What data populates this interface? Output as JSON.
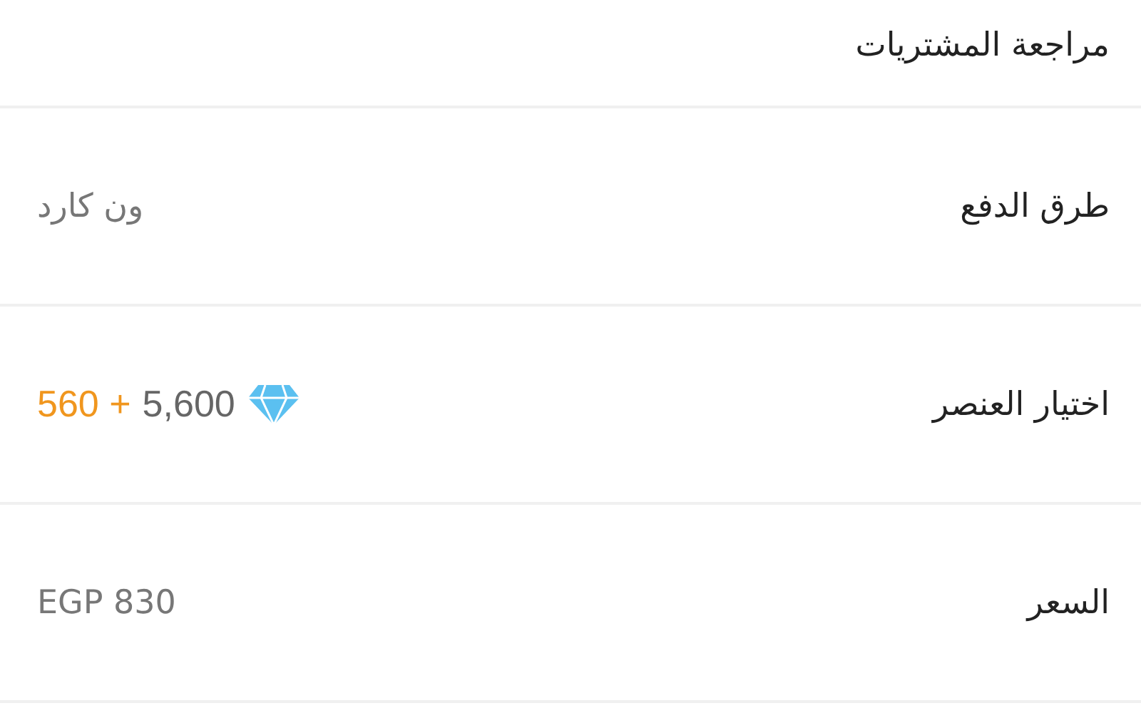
{
  "header": {
    "title": "مراجعة المشتريات"
  },
  "rows": [
    {
      "kind": "text",
      "label": "طرق الدفع",
      "value": "ون كارد"
    },
    {
      "kind": "gems",
      "label": "اختيار العنصر",
      "bonus": "560 +",
      "amount": "5,600"
    },
    {
      "kind": "text",
      "label": "السعر",
      "value": "EGP 830"
    }
  ]
}
